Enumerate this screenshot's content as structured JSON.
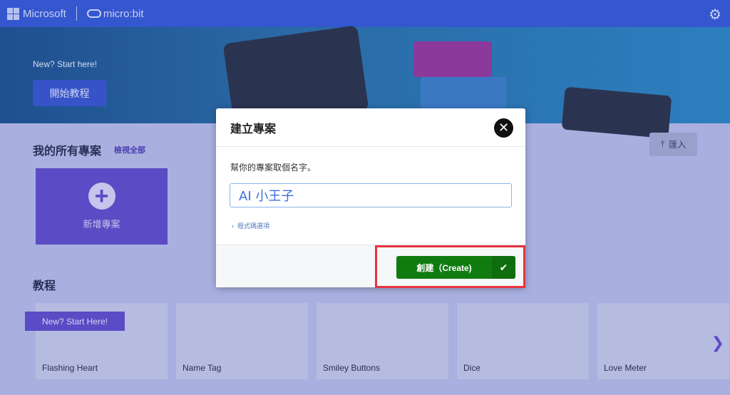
{
  "topbar": {
    "brand": "Microsoft",
    "product": "micro:bit",
    "icons": {
      "logo": "microsoft-logo",
      "microbit": "microbit-logo",
      "settings": "gear-icon"
    }
  },
  "banner": {
    "subtitle": "New? Start here!",
    "start_button": "開始教程"
  },
  "projects": {
    "title": "我的所有專案",
    "view_all": "檢視全部",
    "import_button": "匯入",
    "new_project": "新增專案"
  },
  "tutorials": {
    "title": "教程",
    "ribbon": "New? Start Here!",
    "cards": [
      {
        "label": "Flashing Heart"
      },
      {
        "label": "Name Tag"
      },
      {
        "label": "Smiley Buttons"
      },
      {
        "label": "Dice"
      },
      {
        "label": "Love Meter"
      }
    ]
  },
  "modal": {
    "title": "建立專案",
    "prompt": "幫你的專案取個名字。",
    "name_value": "AI 小王子",
    "code_options": "程式碼選項",
    "create_button": "創建（Create)",
    "colors": {
      "create": "#107c10",
      "highlight": "#e8333f"
    }
  }
}
